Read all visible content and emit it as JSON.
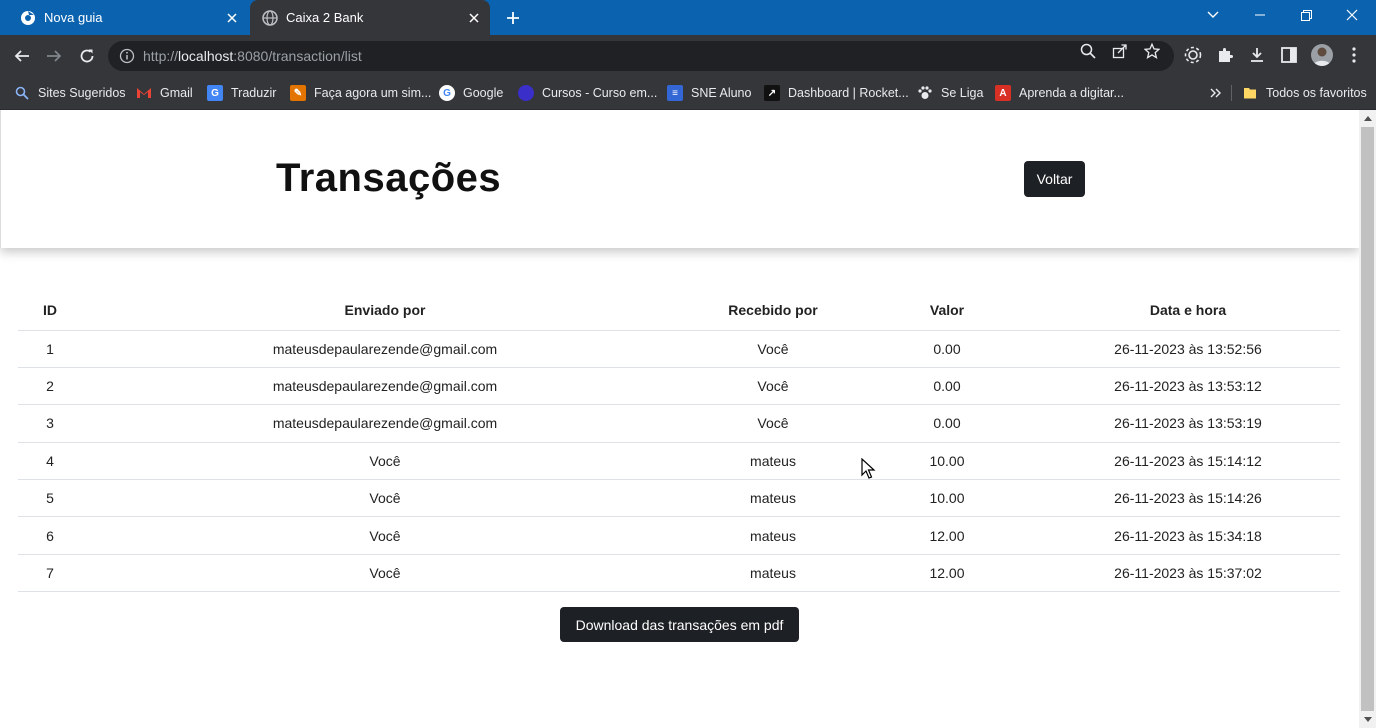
{
  "browser": {
    "tabs": [
      {
        "title": "Nova guia",
        "active": false
      },
      {
        "title": "Caixa 2 Bank",
        "active": true
      }
    ],
    "url_prefix": "http://",
    "url_host": "localhost",
    "url_rest": ":8080/transaction/list",
    "bookmarks": [
      {
        "label": "Sites Sugeridos",
        "icon": "search-icon",
        "color": "#8ab4f8"
      },
      {
        "label": "Gmail",
        "icon": "gmail-icon",
        "color": "#ea4335"
      },
      {
        "label": "Traduzir",
        "icon": "translate-icon",
        "color": "#4285f4"
      },
      {
        "label": "Faça agora um sim...",
        "icon": "form-icon",
        "color": "#e37400"
      },
      {
        "label": "Google",
        "icon": "google-icon",
        "color": "#ffffff"
      },
      {
        "label": "Cursos - Curso em...",
        "icon": "course-icon",
        "color": "#3b2fc9"
      },
      {
        "label": "SNE Aluno",
        "icon": "sne-icon",
        "color": "#3367d6"
      },
      {
        "label": "Dashboard | Rocket...",
        "icon": "rocket-icon",
        "color": "#111111"
      },
      {
        "label": "Se Liga",
        "icon": "paw-icon",
        "color": "#202124"
      },
      {
        "label": "Aprenda a digitar...",
        "icon": "typing-icon",
        "color": "#d93025"
      }
    ],
    "all_bookmarks_label": "Todos os favoritos"
  },
  "page": {
    "title": "Transações",
    "back_button": "Voltar",
    "table": {
      "headers": [
        "ID",
        "Enviado por",
        "Recebido por",
        "Valor",
        "Data e hora"
      ],
      "rows": [
        [
          "1",
          "mateusdepaularezende@gmail.com",
          "Você",
          "0.00",
          "26-11-2023 às 13:52:56"
        ],
        [
          "2",
          "mateusdepaularezende@gmail.com",
          "Você",
          "0.00",
          "26-11-2023 às 13:53:12"
        ],
        [
          "3",
          "mateusdepaularezende@gmail.com",
          "Você",
          "0.00",
          "26-11-2023 às 13:53:19"
        ],
        [
          "4",
          "Você",
          "mateus",
          "10.00",
          "26-11-2023 às 15:14:12"
        ],
        [
          "5",
          "Você",
          "mateus",
          "10.00",
          "26-11-2023 às 15:14:26"
        ],
        [
          "6",
          "Você",
          "mateus",
          "12.00",
          "26-11-2023 às 15:34:18"
        ],
        [
          "7",
          "Você",
          "mateus",
          "12.00",
          "26-11-2023 às 15:37:02"
        ]
      ]
    },
    "download_button": "Download das transações em pdf"
  }
}
